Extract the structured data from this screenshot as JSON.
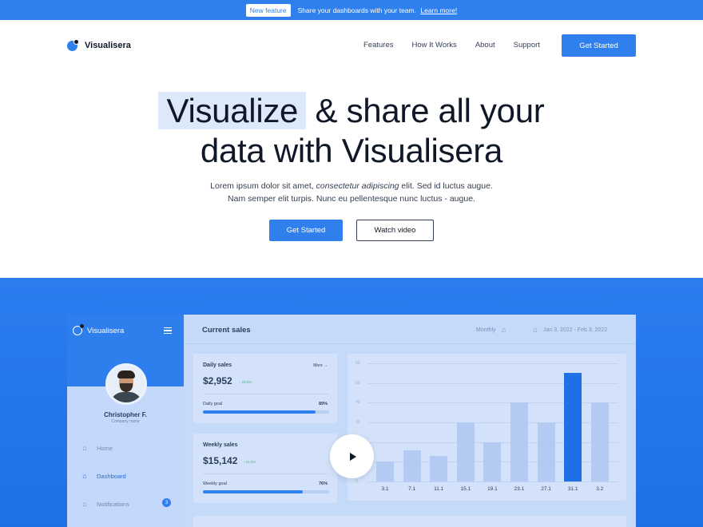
{
  "announcement": {
    "badge": "New feature",
    "text": "Share your dashboards with your team.",
    "link": "Learn more!"
  },
  "brand": {
    "name": "Visualisera",
    "accent": "#2f80ed",
    "dark": "#101828"
  },
  "nav": {
    "items": [
      "Features",
      "How It Works",
      "About",
      "Support"
    ],
    "cta": "Get Started"
  },
  "hero": {
    "title_highlight": "Visualize",
    "title_rest_line1": "& share all your",
    "title_line2": "data with Visualisera",
    "desc_line1_a": "Lorem ipsum dolor sit amet, ",
    "desc_line1_em": "consectetur adipiscing",
    "desc_line1_b": " elit. Sed id luctus augue.",
    "desc_line2": "Nam semper elit turpis. Nunc eu pellentesque nunc luctus - augue.",
    "primary_button": "Get Started",
    "secondary_button": "Watch video"
  },
  "dashboard": {
    "sidebar": {
      "logo": "Visualisera",
      "user_name": "Christopher F.",
      "user_role": "Company name",
      "menu": [
        {
          "label": "Home",
          "icon": "home-icon",
          "active": false
        },
        {
          "label": "Dashboard",
          "icon": "home-icon",
          "active": true
        },
        {
          "label": "Notifications",
          "icon": "home-icon",
          "active": false,
          "badge": "3"
        }
      ]
    },
    "header": {
      "title": "Current sales",
      "filter": "Monthly",
      "date_range": "Jan 3, 2022 - Feb 3, 2022"
    },
    "daily": {
      "title": "Daily sales",
      "more": "More →",
      "value": "$2,952",
      "change": "↑ 23.8%",
      "goal_label": "Daily goal",
      "goal_pct": "89%",
      "goal_fraction": 0.89
    },
    "weekly": {
      "title": "Weekly sales",
      "value": "$15,142",
      "change": "↑ 23.8%",
      "goal_label": "Weekly goal",
      "goal_pct": "76%",
      "goal_fraction": 0.79
    }
  },
  "chart_data": {
    "type": "bar",
    "categories": [
      "3.1",
      "7.1",
      "11.1",
      "15.1",
      "19.1",
      "23.1",
      "27.1",
      "31.1",
      "3.2"
    ],
    "values": [
      10,
      16,
      13,
      30,
      20,
      40,
      30,
      55,
      40
    ],
    "highlight_index": 7,
    "yticks": [
      "60",
      "50",
      "40",
      "30",
      "20",
      "10",
      "0"
    ],
    "ylim": [
      0,
      60
    ],
    "colors": {
      "bar": "#b3cbf2",
      "highlight": "#1f6fe6"
    }
  }
}
